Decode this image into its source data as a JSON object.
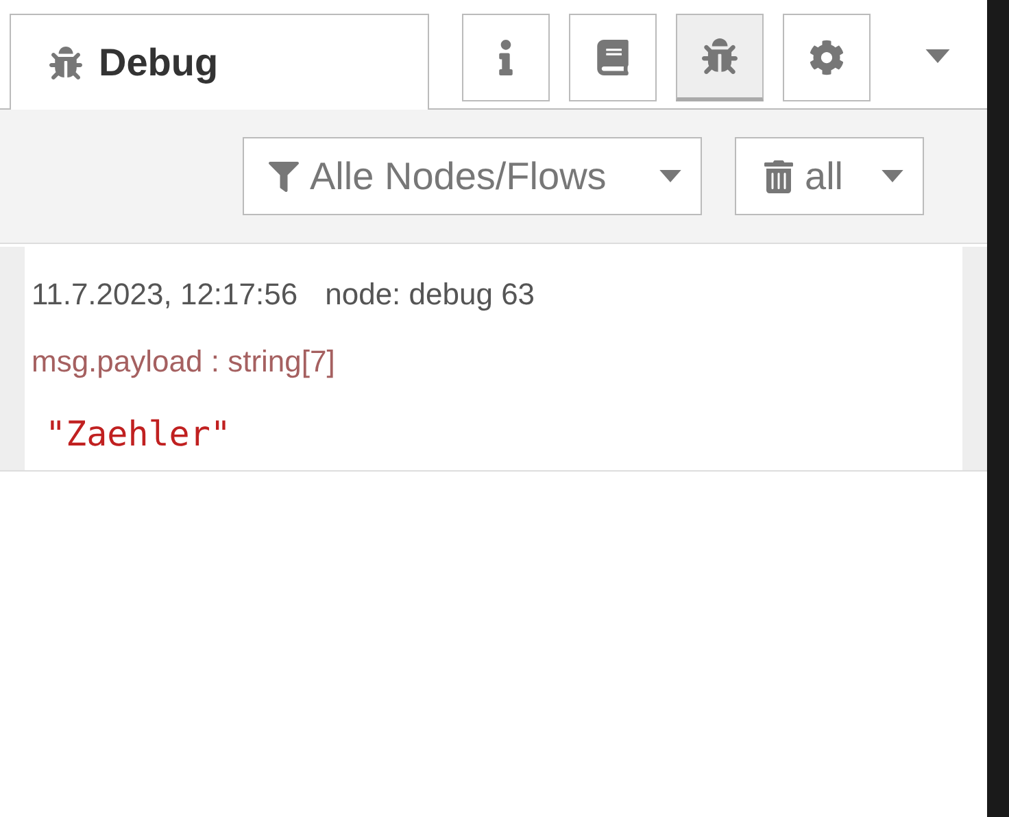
{
  "tab": {
    "label": "Debug",
    "selected": true
  },
  "sidebar_buttons": [
    {
      "kind": "info",
      "selected": false
    },
    {
      "kind": "book",
      "selected": false
    },
    {
      "kind": "bug",
      "selected": true
    },
    {
      "kind": "gear",
      "selected": false
    }
  ],
  "filter": {
    "label": "Alle Nodes/Flows"
  },
  "clear": {
    "label": "all"
  },
  "messages": [
    {
      "timestamp": "11.7.2023, 12:17:56",
      "node": "node: debug 63",
      "meta": "msg.payload : string[7]",
      "value": "\"Zaehler\""
    }
  ]
}
